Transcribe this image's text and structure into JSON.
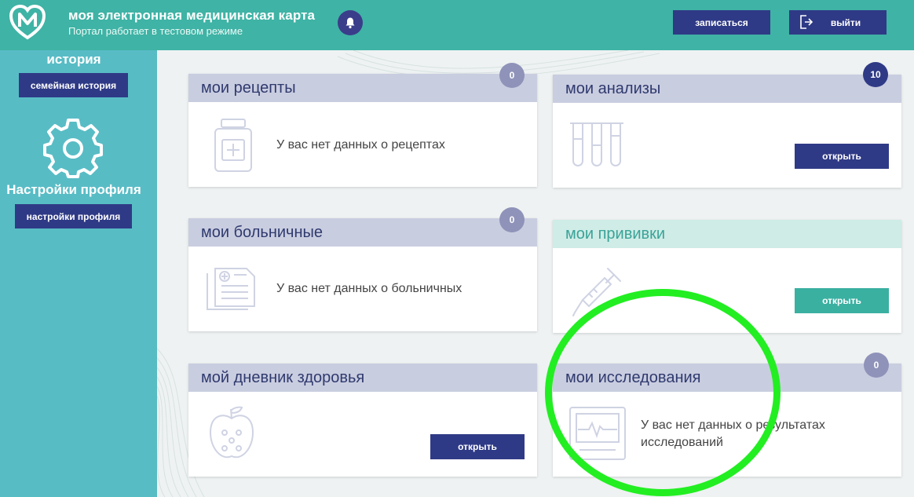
{
  "header": {
    "title": "моя электронная медицинская карта",
    "subtitle": "Портал работает в тестовом режиме",
    "book_label": "записаться",
    "exit_label": "выйти"
  },
  "sidebar": {
    "heading_family": "история",
    "family_button": "семейная история",
    "heading_settings": "Настройки профиля",
    "settings_button": "настройки профиля"
  },
  "cards": {
    "prescriptions": {
      "title": "мои рецепты",
      "badge": "0",
      "text": "У вас нет данных о рецептах"
    },
    "analyses": {
      "title": "мои анализы",
      "badge": "10",
      "button": "открыть"
    },
    "sick_leave": {
      "title": "мои больничные",
      "badge": "0",
      "text": "У вас нет данных о больничных"
    },
    "vaccinations": {
      "title": "мои прививки",
      "button": "открыть"
    },
    "diary": {
      "title": "мой дневник здоровья",
      "button": "открыть"
    },
    "studies": {
      "title": "мои исследования",
      "badge": "0",
      "text": "У вас нет данных о результатах исследований"
    }
  },
  "colors": {
    "header": "#3fb3a5",
    "sidebar": "#58bcc5",
    "primary_button": "#2f3a86",
    "teal_button": "#3ab0a1",
    "highlight": "#22ee22"
  },
  "icons": {
    "logo": "heart-m-logo-icon",
    "bell": "bell-icon",
    "exit": "exit-icon",
    "settings": "gear-icon",
    "prescriptions": "medicine-bottle-icon",
    "analyses": "test-tubes-icon",
    "sick_leave": "medical-document-icon",
    "vaccinations": "syringe-icon",
    "diary": "apple-icon",
    "studies": "monitor-ecg-icon"
  }
}
